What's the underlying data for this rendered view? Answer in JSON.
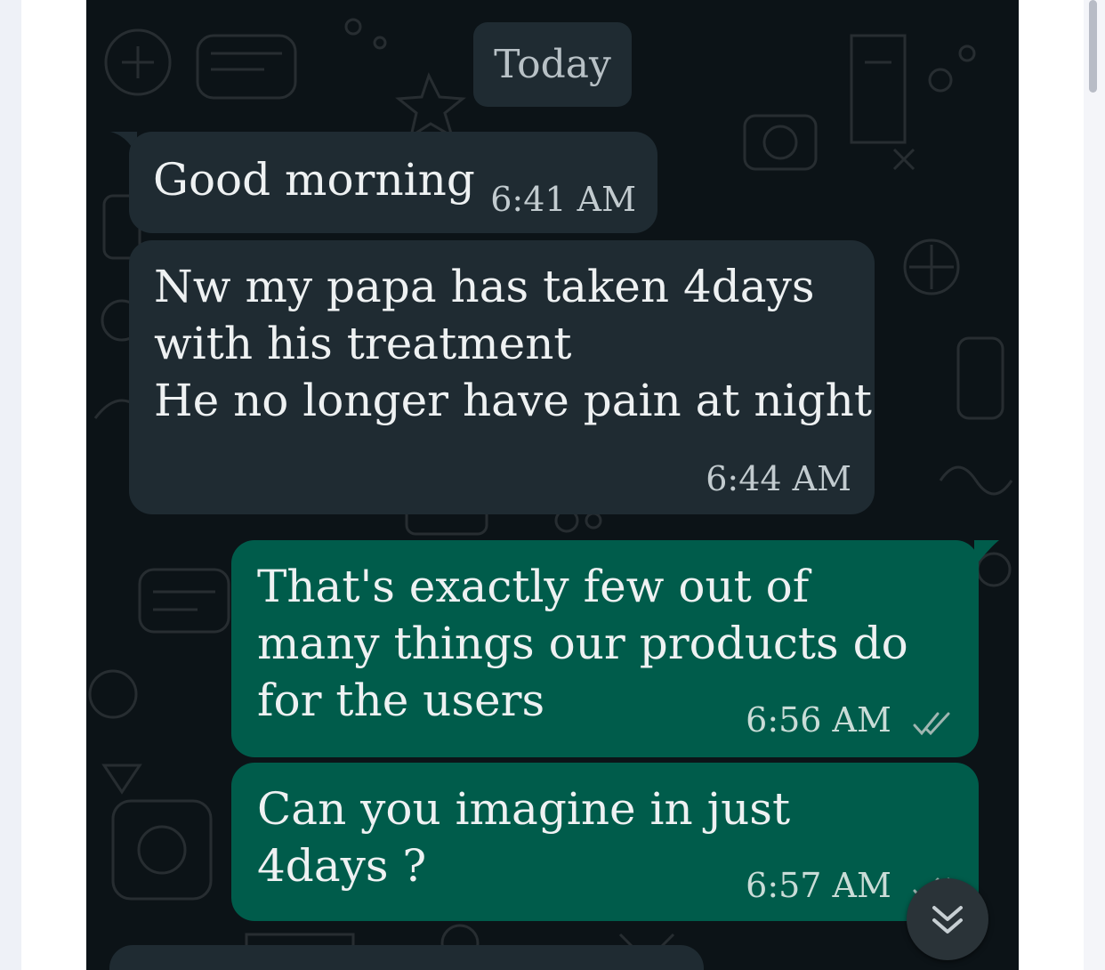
{
  "chat": {
    "date_label": "Today",
    "messages": [
      {
        "direction": "incoming",
        "text": "Good morning",
        "time": "6:41 AM"
      },
      {
        "direction": "incoming",
        "text": "Nw my papa has taken 4days\nwith his treatment\nHe no longer have pain at night",
        "time": "6:44 AM"
      },
      {
        "direction": "outgoing",
        "text": "That's exactly few out of\nmany things our products do\nfor the users",
        "time": "6:56 AM",
        "status": "read"
      },
      {
        "direction": "outgoing",
        "text": "Can you imagine in just\n4days ?",
        "time": "6:57 AM",
        "status": "read"
      }
    ],
    "scroll_button_icon": "double-chevron-down-icon",
    "read_receipt_icon": "double-check-icon"
  },
  "colors": {
    "chat_background": "#0c1317",
    "incoming_bubble": "#1f2b32",
    "outgoing_bubble": "#005c4b",
    "text": "#eef1f2",
    "read_ticks": "#53bdeb"
  }
}
